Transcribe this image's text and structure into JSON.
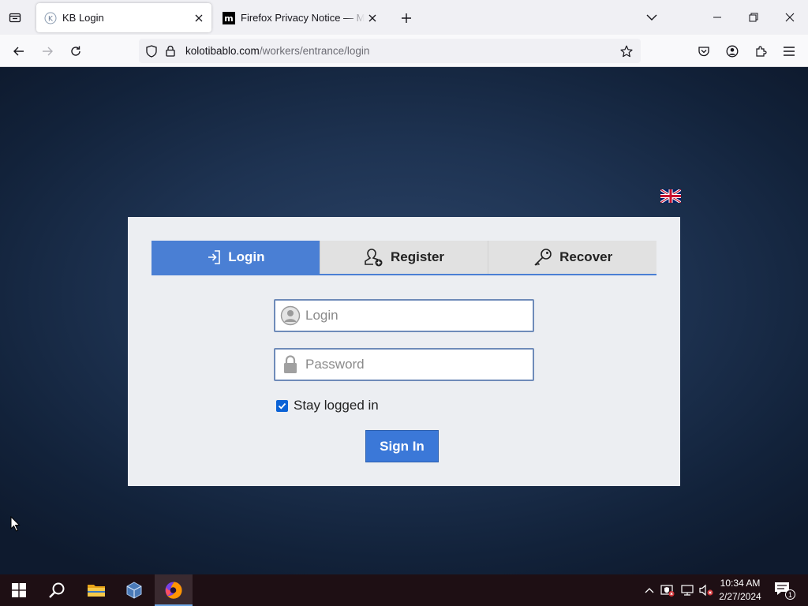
{
  "browser": {
    "tabs": [
      {
        "title": "KB Login",
        "favicon_letter": "K"
      },
      {
        "title": "Firefox Privacy Notice — Mozilla",
        "favicon_letter": "m"
      }
    ],
    "url_domain": "kolotibablo.com",
    "url_path": "/workers/entrance/login",
    "accent_color": "#0b62d6"
  },
  "page": {
    "tabs": [
      {
        "label": "Login",
        "icon": "login-arrow-icon"
      },
      {
        "label": "Register",
        "icon": "add-user-icon"
      },
      {
        "label": "Recover",
        "icon": "key-icon"
      }
    ],
    "login_placeholder": "Login",
    "password_placeholder": "Password",
    "stay_logged_in_label": "Stay logged in",
    "stay_logged_in_checked": true,
    "sign_in_label": "Sign In",
    "primary_color": "#4a7fd4",
    "language": "en-GB"
  },
  "taskbar": {
    "time": "10:34 AM",
    "date": "2/27/2024",
    "notification_count": "1"
  }
}
